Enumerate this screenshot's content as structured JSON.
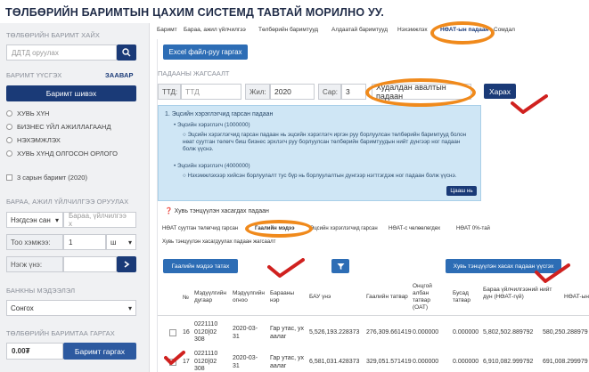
{
  "header": {
    "title": "ТӨЛБӨРИЙН БАРИМТЫН ЦАХИМ СИСТЕМД ТАВТАЙ МОРИЛНО УУ."
  },
  "sidebar": {
    "search_title": "ТӨЛБӨРИЙН БАРИМТ ХАЙХ",
    "search_placeholder": "ДДТД оруулах",
    "type_title": "БАРИМТ ҮҮСГЭХ",
    "guide_link": "ЗААВАР",
    "print_button": "Баримт шивэх",
    "radios": [
      "ХУВЬ ХҮН",
      "БИЗНЕС ҮЙЛ АЖИЛЛАГААНД",
      "НЭХЭМЖЛЭХ",
      "ХУВЬ ХҮНД ОЛГОСОН ОРЛОГО"
    ],
    "checkbox_label": "3 сарын баримт (2020)",
    "goods_title": "БАРАА, АЖИЛ ҮЙЛЧИЛГЭЭ ОРУУЛАХ",
    "goods_select": "Нэгдсэн сан",
    "goods_placeholder": "Бараа, үйлчилгээ х",
    "qty_label": "Тоо хэмжээ:",
    "qty_value": "1",
    "unit_value": "ш",
    "price_label": "Нэгж үнэ:",
    "bank_title": "БАНКНЫ МЭДЭЭЛЭЛ",
    "bank_select": "Сонгох",
    "amount_title": "ТӨЛБӨРИЙН БАРИМТАА ГАРГАХ",
    "amount_value": "0.00₮",
    "issue_button": "Баримт гаргах"
  },
  "tabs": [
    "Баримт",
    "Бараа, ажил үйлчилгээ",
    "Төлбөрийн баримтууд",
    "Алдаатай баримтууд",
    "Нэхэмжлэх",
    "НӨАТ-ын падаан",
    "Сомдал"
  ],
  "panel": {
    "excel_button": "Excel файл-руу гаргах",
    "section_label": "ПАДААНЫ ЖАГСААЛТ",
    "ttd_label": "ТТД:",
    "ttd_placeholder": "ТТД",
    "year_label": "Жил:",
    "year_value": "2020",
    "month_label": "Сар:",
    "month_value": "3",
    "type_select": "Худалдан авалтын падаан",
    "search_button": "Харах",
    "info": {
      "title": "1. Эцсийн хэрэглэгчид гарсан падаан",
      "item1": "Эцсийн хэрэглэгч (1000000)",
      "desc1": "Эцсийн хэрэглэгчид гарсан падаан нь эцсийн хэрэглэгч иргэн руу борлуулсан төлбөрийн баримтууд болон нөат суутган төлөгч биш бизнес эрхлэгч руу борлуулсан төлбөрийн баримтуудын нийт дүнгээр ног падаан болж үүснэ.",
      "item2": "Эцсийн хэрэглэгч (4000000)",
      "desc2": "Нэхэмжлэхээр хийсэн борлуулалт тус бүр нь борлуулалтын дүнгээр нэгтгэгдэж ног падаан болж үүснэ.",
      "more_button": "Цааш нь"
    },
    "accept_label": "Хувь тэнцүүлэн хасагдах падаан",
    "subtabs": [
      "НӨАТ суутган төлөгчид гарсан",
      "Гаалийн мэдээ",
      "Эцсийн хэрэглэгчид гарсан",
      "НӨАТ-с чөлөөлөгдөх",
      "НӨАТ 0%-тай"
    ],
    "subtab_row2": "Хувь тэнцүүлэн хасагдуулах падаан жагсаалт",
    "customs_button": "Гаалийн мэдээ татах",
    "filter_icon": "filter-icon",
    "deduct_button": "Хувь тэнцүүлэн хасах падаан үүсгэх",
    "table": {
      "headers": [
        "№",
        "Мэдүүлгийн дугаар",
        "Мэдүүлгийн огноо",
        "Барааны нэр",
        "БАУ үнэ",
        "Гаалийн татвар",
        "Онцгой албан татвар (ОАТ)",
        "Бусад татвар",
        "Бараа үйлчилгээний нийт дүн (НӨАТ-гүй)",
        "НӨАТ-ын дүн"
      ],
      "rows": [
        [
          "16",
          "0221110\n0120|02\n308",
          "2020-03-\n31",
          "Гар утас, ух\nаалаг",
          "5,526,193.228373",
          "276,309.661419",
          "0.000000",
          "0.000000",
          "5,802,502.889792",
          "580,250.288979"
        ],
        [
          "17",
          "0221110\n0120|02\n308",
          "2020-03-\n31",
          "Гар утас, ух\nаалаг",
          "6,581,031.428373",
          "329,051.571419",
          "0.000000",
          "0.000000",
          "6,910,082.999792",
          "691,008.299979"
        ]
      ]
    }
  },
  "colors": {
    "accent": "#1a3a77",
    "button_blue": "#2d6db5",
    "annotation": "#f08a1c",
    "check": "#d0211f"
  }
}
